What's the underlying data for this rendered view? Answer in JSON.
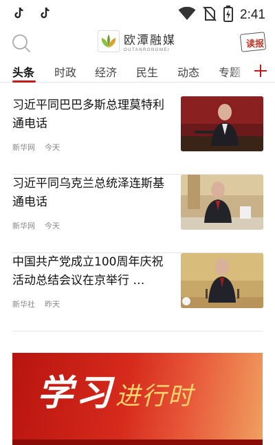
{
  "status_bar": {
    "time": "2:41",
    "icons": [
      "tiktok-icon",
      "tiktok-icon",
      "wifi-icon",
      "no-sim-icon",
      "battery-icon"
    ]
  },
  "header": {
    "logo_cn": "欧潭融媒",
    "logo_en": "OUTANRONGMEI",
    "read_label": "读报",
    "search_icon": "search-icon"
  },
  "tabs": [
    {
      "label": "头条",
      "active": true
    },
    {
      "label": "时政",
      "active": false
    },
    {
      "label": "经济",
      "active": false
    },
    {
      "label": "民生",
      "active": false
    },
    {
      "label": "动态",
      "active": false
    },
    {
      "label": "专题",
      "active": false
    }
  ],
  "news": [
    {
      "title": "习近平同巴巴多斯总理莫特利通电话",
      "source": "新华网",
      "time": "今天"
    },
    {
      "title": "习近平同乌克兰总统泽连斯基通电话",
      "source": "新华网",
      "time": "今天"
    },
    {
      "title": "中国共产党成立100周年庆祝活动总结会议在京举行 …",
      "source": "新华社",
      "time": "昨天"
    }
  ],
  "banner": {
    "title": "学习",
    "subtitle": "进行时"
  },
  "colors": {
    "accent": "#c21a1a",
    "tab_text": "#444444",
    "meta_text": "#888888"
  }
}
